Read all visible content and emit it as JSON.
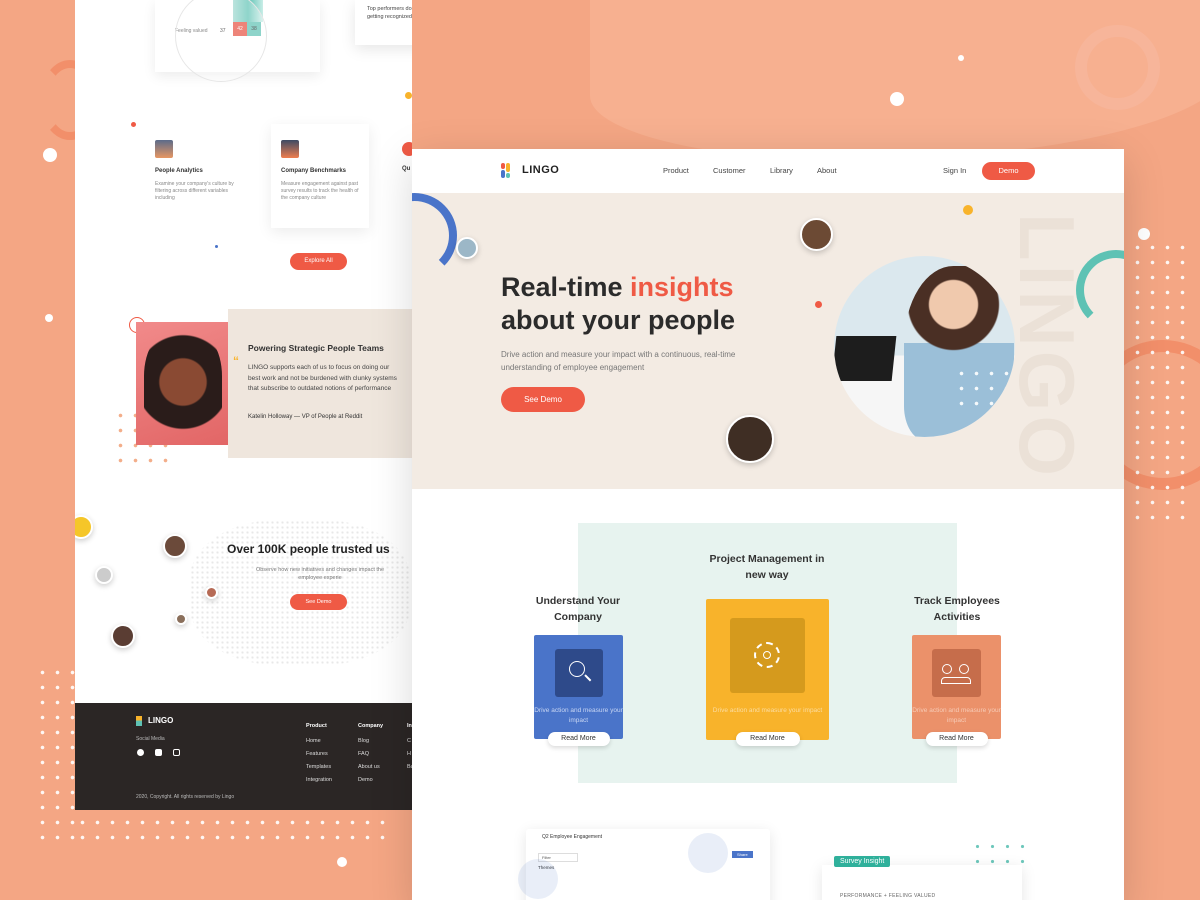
{
  "back": {
    "top_card_quote": "Top performers don't feel like they're getting recognized for their work.",
    "table_label": "Feeling valued",
    "table_values": [
      "37",
      "42",
      "38"
    ],
    "features": [
      {
        "title": "People Analytics",
        "desc": "Examine your company's culture by filtering across different variables including"
      },
      {
        "title": "Company Benchmarks",
        "desc": "Measure engagement against past survey results to track the health of the company culture"
      },
      {
        "title": "Qu",
        "desc": ""
      }
    ],
    "explore_button": "Explore All",
    "testimonial": {
      "title": "Powering Strategic People Teams",
      "quote": "LINGO supports each of us to focus on doing our best work and not be burdened with clunky systems that subscribe to outdated notions of performance",
      "author": "Katelin Holloway — VP of People at Reddit"
    },
    "trusted": {
      "title": "Over 100K people trusted us",
      "desc": "Observe how new initiatives and changes impact the employee experie",
      "button": "See Demo"
    },
    "footer": {
      "brand": "LINGO",
      "social_label": "Social Media",
      "columns": [
        {
          "title": "Product",
          "items": [
            "Home",
            "Features",
            "Templates",
            "Integration"
          ]
        },
        {
          "title": "Company",
          "items": [
            "Blog",
            "FAQ",
            "About us",
            "Demo"
          ]
        },
        {
          "title": "In",
          "items": [
            "C",
            "H",
            "Ba"
          ]
        }
      ],
      "copyright": "2020, Copyright. All rights reserved by Lingo"
    }
  },
  "front": {
    "brand": "LINGO",
    "nav": [
      "Product",
      "Customer",
      "Library",
      "About"
    ],
    "signin": "Sign In",
    "demo_button": "Demo",
    "hero": {
      "title_a": "Real-time ",
      "title_accent": "insights",
      "title_b": "about your people",
      "subtitle": "Drive action and measure your impact with a continuous, real-time understanding of employee engagement",
      "cta": "See Demo",
      "watermark": "LINGO"
    },
    "features": {
      "center_title": "Project Management in new way",
      "left_title": "Understand Your Company",
      "right_title": "Track Employees Activities",
      "card_text": "Drive action and measure your impact",
      "read_more": "Read More"
    },
    "dashboard": {
      "title": "Q2 Employee Engagement",
      "tab": "Themes",
      "filter": "Filter",
      "button": "Share"
    },
    "survey": {
      "badge": "Survey Insight",
      "sub": "PERFORMANCE + FEELING VALUED"
    }
  },
  "colors": {
    "accent": "#ef5a45",
    "teal": "#5ec2b4",
    "blue": "#4a74c9",
    "yellow": "#f8b32b",
    "salmon": "#eb916a"
  }
}
